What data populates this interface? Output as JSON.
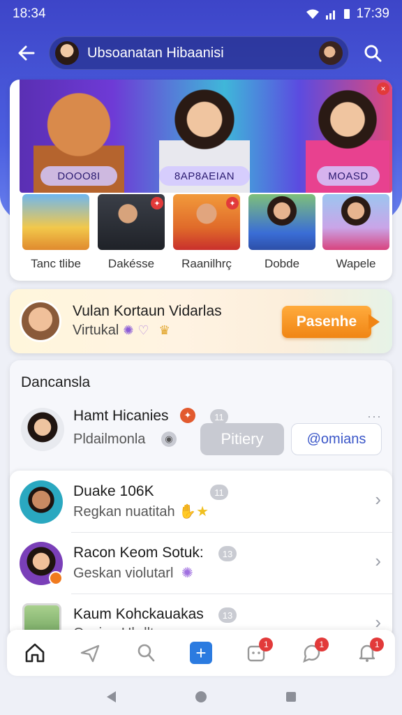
{
  "status_bar": {
    "time": "18:34",
    "right_time": "17:39"
  },
  "app_bar": {
    "title": "Ubsoanatan Hibaanisi"
  },
  "banner": {
    "hero_labels": [
      "DOOO8I",
      "8AP8AEIAN",
      "MOASD"
    ],
    "thumbs": [
      {
        "label": "Tanc tlibe",
        "badge": ""
      },
      {
        "label": "Dakésse",
        "badge": "✦"
      },
      {
        "label": "Raanilhrç",
        "badge": "✦"
      },
      {
        "label": "Dobde",
        "badge": ""
      },
      {
        "label": "Wapele",
        "badge": ""
      }
    ]
  },
  "promo": {
    "title": "Vulan Kortaun Vidarlas",
    "subtitle": "Virtukal",
    "cta": "Pasenhe"
  },
  "section": {
    "title": "Dancansla",
    "request": {
      "name": "Hamt Hicanies",
      "sub": "Pldailmonla",
      "count": "11",
      "decline_label": "Pitiery",
      "accept_label": "@omians"
    },
    "items": [
      {
        "name": "Duake 106K",
        "sub": "Regkan nuatitah",
        "count": "11"
      },
      {
        "name": "Racon Keom Sotuk:",
        "sub": "Geskan violutarl",
        "count": "13"
      },
      {
        "name": "Kaum Kohckauakas",
        "sub": "Oacian Uhdlt",
        "count": "13"
      }
    ]
  },
  "bottom_nav": {
    "items": [
      {
        "name": "home",
        "badge": ""
      },
      {
        "name": "explore",
        "badge": ""
      },
      {
        "name": "search",
        "badge": ""
      },
      {
        "name": "create",
        "badge": ""
      },
      {
        "name": "inbox",
        "badge": "1"
      },
      {
        "name": "chat",
        "badge": "1"
      },
      {
        "name": "notifications",
        "badge": "1"
      }
    ]
  },
  "colors": {
    "primary": "#4a55d6",
    "accent": "#f08514",
    "badge": "#e23a3a"
  }
}
